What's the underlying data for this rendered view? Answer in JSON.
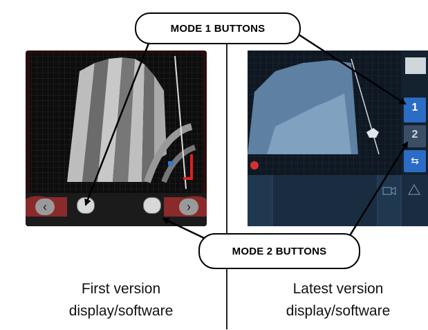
{
  "callouts": {
    "mode1": "MODE 1 BUTTONS",
    "mode2": "MODE 2 BUTTONS"
  },
  "captions": {
    "left_line1": "First version",
    "left_line2": "display/software",
    "right_line1": "Latest version",
    "right_line2": "display/software"
  },
  "new_display": {
    "mode1_key": "1",
    "mode2_key": "2"
  },
  "colors": {
    "old_frame": "#7a1e1e",
    "new_panel": "#1f4a7a",
    "accent_blue": "#2b6cc4"
  }
}
